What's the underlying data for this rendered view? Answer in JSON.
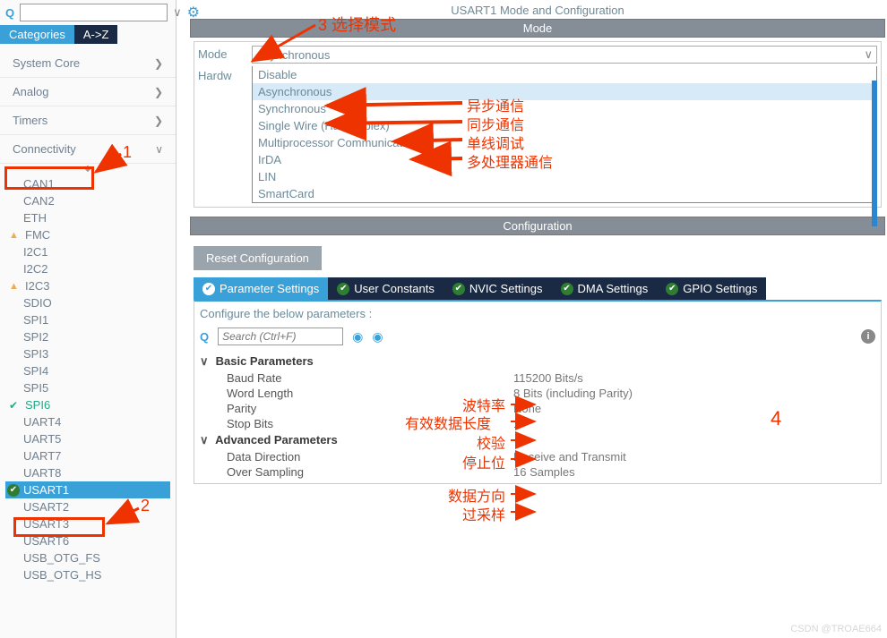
{
  "sidebar": {
    "search_placeholder": "",
    "tabs": {
      "categories": "Categories",
      "az": "A->Z"
    },
    "groups": [
      {
        "label": "System Core",
        "expanded": false
      },
      {
        "label": "Analog",
        "expanded": false
      },
      {
        "label": "Timers",
        "expanded": false
      },
      {
        "label": "Connectivity",
        "expanded": true
      }
    ],
    "connectivity_items": [
      {
        "label": "CAN1",
        "status": ""
      },
      {
        "label": "CAN2",
        "status": ""
      },
      {
        "label": "ETH",
        "status": ""
      },
      {
        "label": "FMC",
        "status": "warn"
      },
      {
        "label": "I2C1",
        "status": ""
      },
      {
        "label": "I2C2",
        "status": ""
      },
      {
        "label": "I2C3",
        "status": "warn"
      },
      {
        "label": "SDIO",
        "status": ""
      },
      {
        "label": "SPI1",
        "status": ""
      },
      {
        "label": "SPI2",
        "status": ""
      },
      {
        "label": "SPI3",
        "status": ""
      },
      {
        "label": "SPI4",
        "status": ""
      },
      {
        "label": "SPI5",
        "status": ""
      },
      {
        "label": "SPI6",
        "status": "check"
      },
      {
        "label": "UART4",
        "status": ""
      },
      {
        "label": "UART5",
        "status": ""
      },
      {
        "label": "UART7",
        "status": ""
      },
      {
        "label": "UART8",
        "status": ""
      },
      {
        "label": "USART1",
        "status": "check-selected"
      },
      {
        "label": "USART2",
        "status": ""
      },
      {
        "label": "USART3",
        "status": ""
      },
      {
        "label": "USART6",
        "status": ""
      },
      {
        "label": "USB_OTG_FS",
        "status": ""
      },
      {
        "label": "USB_OTG_HS",
        "status": ""
      }
    ]
  },
  "main": {
    "title": "USART1 Mode and Configuration",
    "mode_section": "Mode",
    "mode_label": "Mode",
    "hardware_label": "Hardw",
    "mode_selected": "Asynchronous",
    "mode_options": [
      "Disable",
      "Asynchronous",
      "Synchronous",
      "Single Wire (Half-Duplex)",
      "Multiprocessor Communication",
      "IrDA",
      "LIN",
      "SmartCard"
    ],
    "config_section": "Configuration",
    "reset_btn": "Reset Configuration",
    "cfg_tabs": [
      "Parameter Settings",
      "User Constants",
      "NVIC Settings",
      "DMA Settings",
      "GPIO Settings"
    ],
    "param_header": "Configure the below parameters :",
    "param_search_placeholder": "Search (Ctrl+F)",
    "basic_title": "Basic Parameters",
    "advanced_title": "Advanced Parameters",
    "params_basic": [
      {
        "name": "Baud Rate",
        "value": "115200 Bits/s"
      },
      {
        "name": "Word Length",
        "value": "8 Bits (including Parity)"
      },
      {
        "name": "Parity",
        "value": "None"
      },
      {
        "name": "Stop Bits",
        "value": "1"
      }
    ],
    "params_adv": [
      {
        "name": "Data Direction",
        "value": "Receive and Transmit"
      },
      {
        "name": "Over Sampling",
        "value": "16 Samples"
      }
    ]
  },
  "annotations": {
    "n1": "1",
    "n2": "2",
    "n3": "3 选择模式",
    "n4": "4",
    "async": "异步通信",
    "sync": "同步通信",
    "single": "单线调试",
    "multi": "多处理器通信",
    "baud": "波特率",
    "wordlen": "有效数据长度",
    "parity": "校验",
    "stopbits": "停止位",
    "datadir": "数据方向",
    "oversamp": "过采样"
  },
  "watermark": "CSDN @TROAE664"
}
